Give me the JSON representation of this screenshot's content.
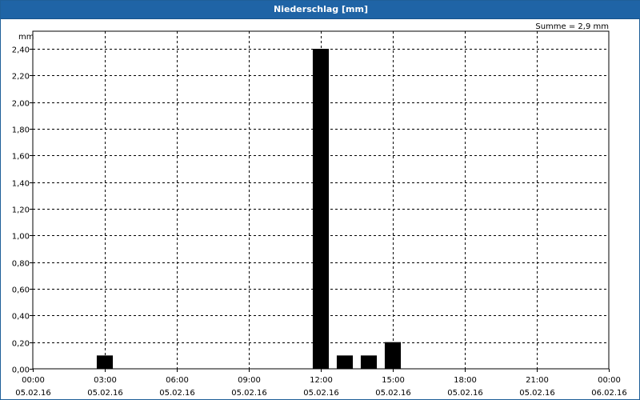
{
  "window": {
    "title": "Niederschlag [mm]"
  },
  "summary": {
    "sum_label": "Summe = 2,9 mm"
  },
  "chart_data": {
    "type": "bar",
    "title": "Niederschlag [mm]",
    "ylabel": "mm",
    "xlabel": "",
    "ylim": [
      0,
      2.4
    ],
    "yticks": [
      0,
      0.2,
      0.4,
      0.6,
      0.8,
      1.0,
      1.2,
      1.4,
      1.6,
      1.8,
      2.0,
      2.2,
      2.4
    ],
    "ytick_labels": [
      "0,00",
      "0,20",
      "0,40",
      "0,60",
      "0,80",
      "1,00",
      "1,20",
      "1,40",
      "1,60",
      "1,80",
      "2,00",
      "2,20",
      "2,40"
    ],
    "xlim_hours": [
      0,
      24
    ],
    "xticks": [
      {
        "time": "00:00",
        "date": "05.02.16",
        "hour": 0
      },
      {
        "time": "03:00",
        "date": "05.02.16",
        "hour": 3
      },
      {
        "time": "06:00",
        "date": "05.02.16",
        "hour": 6
      },
      {
        "time": "09:00",
        "date": "05.02.16",
        "hour": 9
      },
      {
        "time": "12:00",
        "date": "05.02.16",
        "hour": 12
      },
      {
        "time": "15:00",
        "date": "05.02.16",
        "hour": 15
      },
      {
        "time": "18:00",
        "date": "05.02.16",
        "hour": 18
      },
      {
        "time": "21:00",
        "date": "05.02.16",
        "hour": 21
      },
      {
        "time": "00:00",
        "date": "06.02.16",
        "hour": 24
      }
    ],
    "bars": [
      {
        "hour": 3,
        "value": 0.1
      },
      {
        "hour": 12,
        "value": 2.4
      },
      {
        "hour": 13,
        "value": 0.1
      },
      {
        "hour": 14,
        "value": 0.1
      },
      {
        "hour": 15,
        "value": 0.2
      }
    ],
    "grid": true,
    "colors": {
      "bar": "#000000",
      "grid": "#000000",
      "title_bar": "#1f64a6"
    }
  }
}
